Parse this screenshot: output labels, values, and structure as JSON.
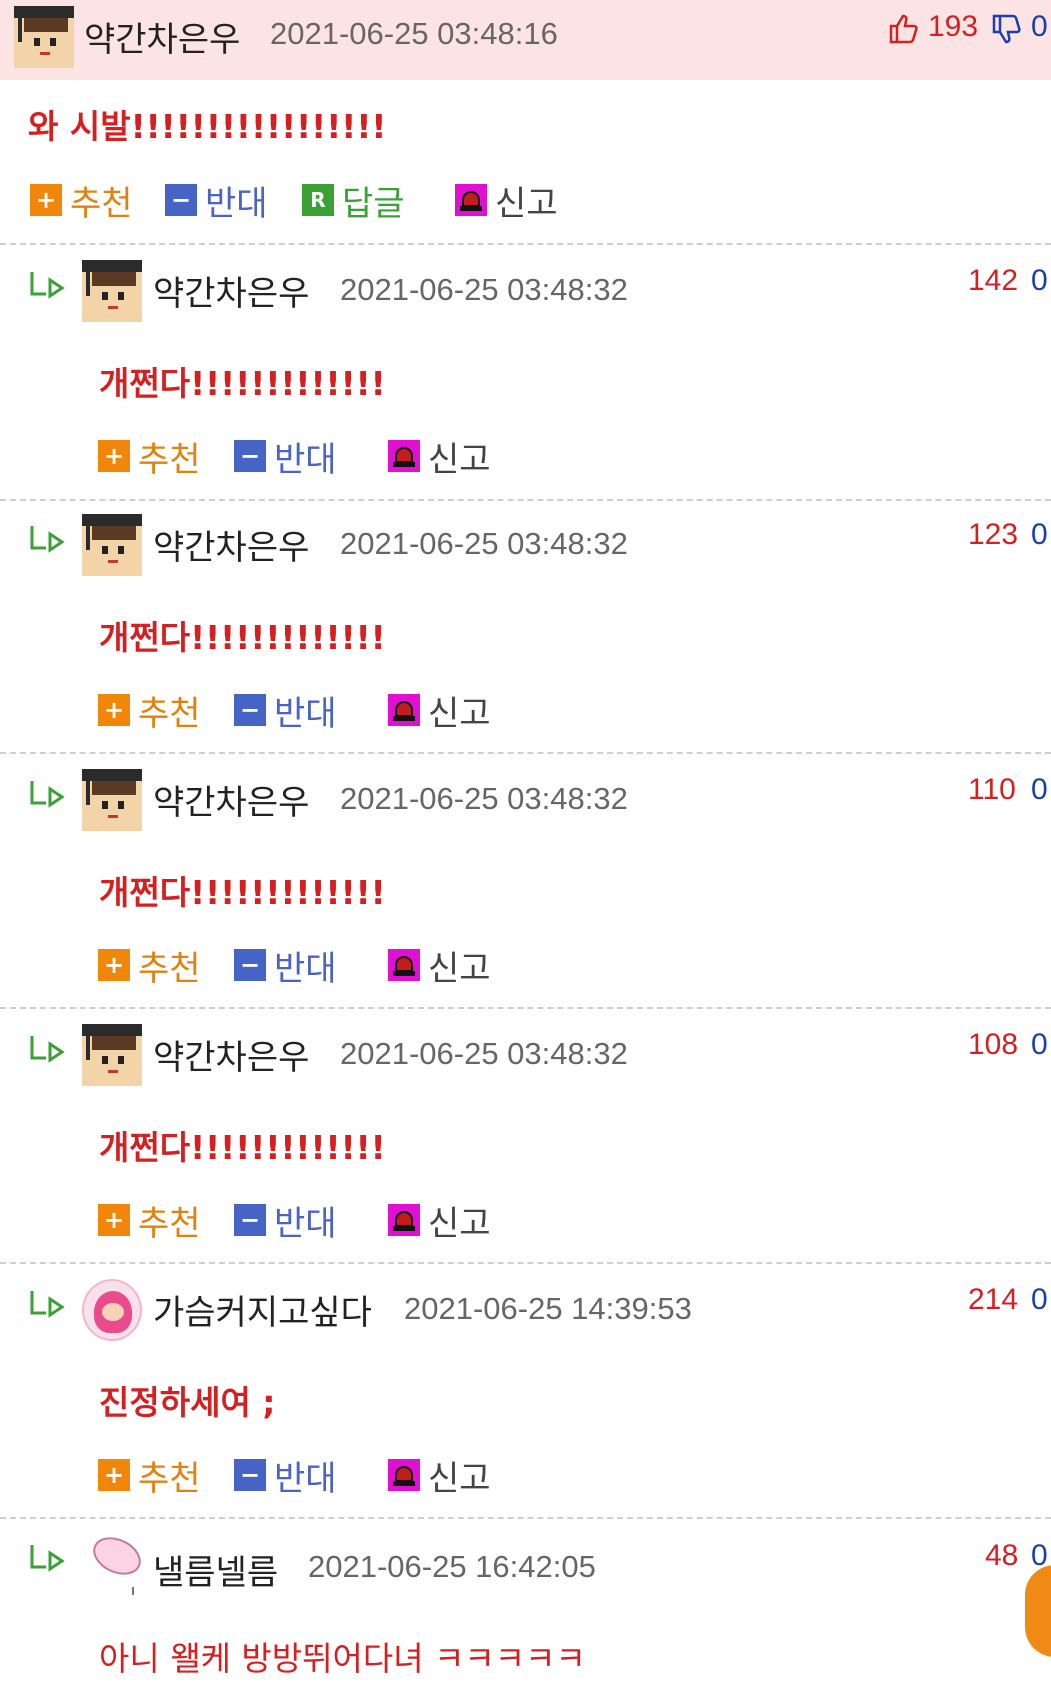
{
  "header_comment": {
    "nick": "약간차은우",
    "date": "2021-06-25 03:48:16",
    "message": "와 시발!!!!!!!!!!!!!!!!!",
    "up_count": "193",
    "down_count": "0",
    "actions": {
      "up": "추천",
      "down": "반대",
      "reply": "답글",
      "report": "신고"
    }
  },
  "replies": [
    {
      "nick": "약간차은우",
      "date": "2021-06-25 03:48:32",
      "message": "개쩐다!!!!!!!!!!!!!",
      "up": "142",
      "down": "0",
      "actions": {
        "up": "추천",
        "down": "반대",
        "report": "신고"
      }
    },
    {
      "nick": "약간차은우",
      "date": "2021-06-25 03:48:32",
      "message": "개쩐다!!!!!!!!!!!!!",
      "up": "123",
      "down": "0",
      "actions": {
        "up": "추천",
        "down": "반대",
        "report": "신고"
      }
    },
    {
      "nick": "약간차은우",
      "date": "2021-06-25 03:48:32",
      "message": "개쩐다!!!!!!!!!!!!!",
      "up": "110",
      "down": "0",
      "actions": {
        "up": "추천",
        "down": "반대",
        "report": "신고"
      }
    },
    {
      "nick": "약간차은우",
      "date": "2021-06-25 03:48:32",
      "message": "개쩐다!!!!!!!!!!!!!",
      "up": "108",
      "down": "0",
      "actions": {
        "up": "추천",
        "down": "반대",
        "report": "신고"
      }
    },
    {
      "nick": "가슴커지고싶다",
      "date": "2021-06-25 14:39:53",
      "message": "진정하세여 ;",
      "up": "214",
      "down": "0",
      "actions": {
        "up": "추천",
        "down": "반대",
        "report": "신고"
      }
    },
    {
      "nick": "낼름넬름",
      "date": "2021-06-25 16:42:05",
      "message": "아니 왤케 방방뛰어다녀 ㅋㅋㅋㅋㅋ",
      "up": "48",
      "down": "0"
    }
  ],
  "icons": {
    "plus": "+",
    "minus": "−",
    "reply": "R"
  },
  "colors": {
    "header_bg": "#fde4e4",
    "message_red": "#d42020",
    "up_orange": "#f0870b",
    "down_blue": "#4564c6",
    "reply_green": "#3aa134",
    "report_magenta": "#e10fd2"
  }
}
